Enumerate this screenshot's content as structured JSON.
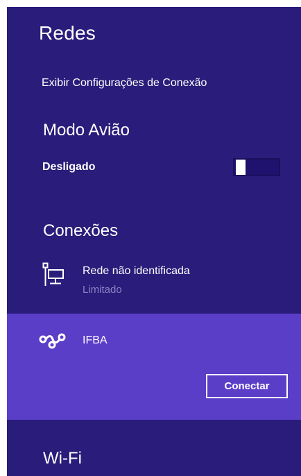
{
  "panel": {
    "title": "Redes",
    "view_settings_link": "Exibir Configurações de Conexão",
    "background_color": "#2a1c7a"
  },
  "airplane_mode": {
    "heading": "Modo Avião",
    "status": "Desligado",
    "toggle_on": false
  },
  "connections": {
    "heading": "Conexões",
    "items": [
      {
        "name": "Rede não identificada",
        "status": "Limitado",
        "icon": "wired-network-icon"
      },
      {
        "name": "IFBA",
        "icon": "cellular-network-icon",
        "selected": true,
        "highlight_color": "#5b3ec8",
        "connect_label": "Conectar"
      }
    ]
  },
  "wifi": {
    "heading": "Wi-Fi"
  }
}
